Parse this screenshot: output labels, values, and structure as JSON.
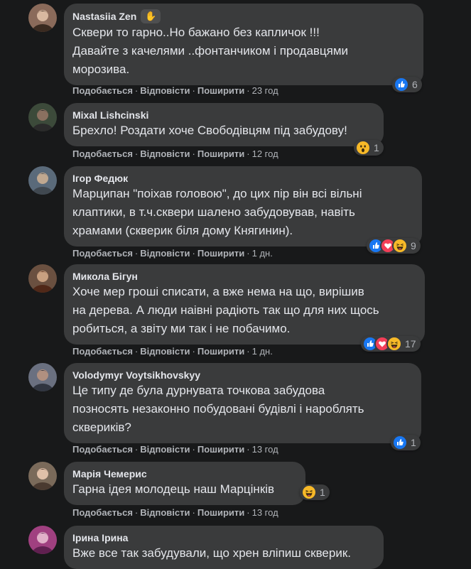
{
  "actions": {
    "like": "Подобається",
    "reply": "Відповісти",
    "share": "Поширити",
    "dot": "·"
  },
  "comments": [
    {
      "author": "Nastasiia Zen",
      "has_badge": true,
      "badge_icon": "wave-hand-icon",
      "lines": [
        "Сквери то гарно..Но бажано без капличок !!!",
        "Давайте з качелями ..фонтанчиком і продавцями",
        "морозива."
      ],
      "time": "23 год",
      "reactions": [
        "like"
      ],
      "count": "6"
    },
    {
      "author": "Mixal Lishcinski",
      "lines": [
        "Брехло! Роздати хоче Свободівцям під забудову!"
      ],
      "time": "12 год",
      "reactions": [
        "wow"
      ],
      "count": "1"
    },
    {
      "author": "Ігор Федюк",
      "lines": [
        "Марципан \"поіхав головою\", до цих пір він всі вільні",
        "клаптики, в т.ч.сквери шалено забудовував, навіть",
        "храмами (скверик біля дому Княгинин)."
      ],
      "time": "1 дн.",
      "reactions": [
        "like",
        "love",
        "haha"
      ],
      "count": "9"
    },
    {
      "author": "Микола Бігун",
      "lines": [
        "Хоче мер гроші списати, а вже нема на що, вирішив",
        "на дерева. А люди наівні радіють так що для них щось",
        "робиться, а звіту ми так і не побачимо."
      ],
      "time": "1 дн.",
      "reactions": [
        "like",
        "love",
        "haha"
      ],
      "count": "17"
    },
    {
      "author": "Volodymyr Voytsikhovskyy",
      "lines": [
        "Це типу де була дурнувата точкова забудова",
        "позносять незаконно побудовані будівлі і нароблять",
        "скверикiв?"
      ],
      "time": "13 год",
      "reactions": [
        "like"
      ],
      "count": "1"
    },
    {
      "author": "Марія Чемерис",
      "lines": [
        "Гарна ідея молодець наш Марцінків"
      ],
      "time": "13 год",
      "reactions": [
        "haha"
      ],
      "count": "1"
    },
    {
      "author": "Ірина Ірина",
      "lines": [
        "Вже все так забудували, що хрен вліпиш скверик."
      ],
      "time": "",
      "reactions": [],
      "count": ""
    }
  ],
  "colors": {
    "background": "#18191a",
    "bubble": "#3a3b3c",
    "text": "#e4e6eb",
    "secondary": "#b0b3b8",
    "like_blue": "#1877f2",
    "love_red": "#f33e58",
    "haha_yellow": "#f7b928"
  }
}
